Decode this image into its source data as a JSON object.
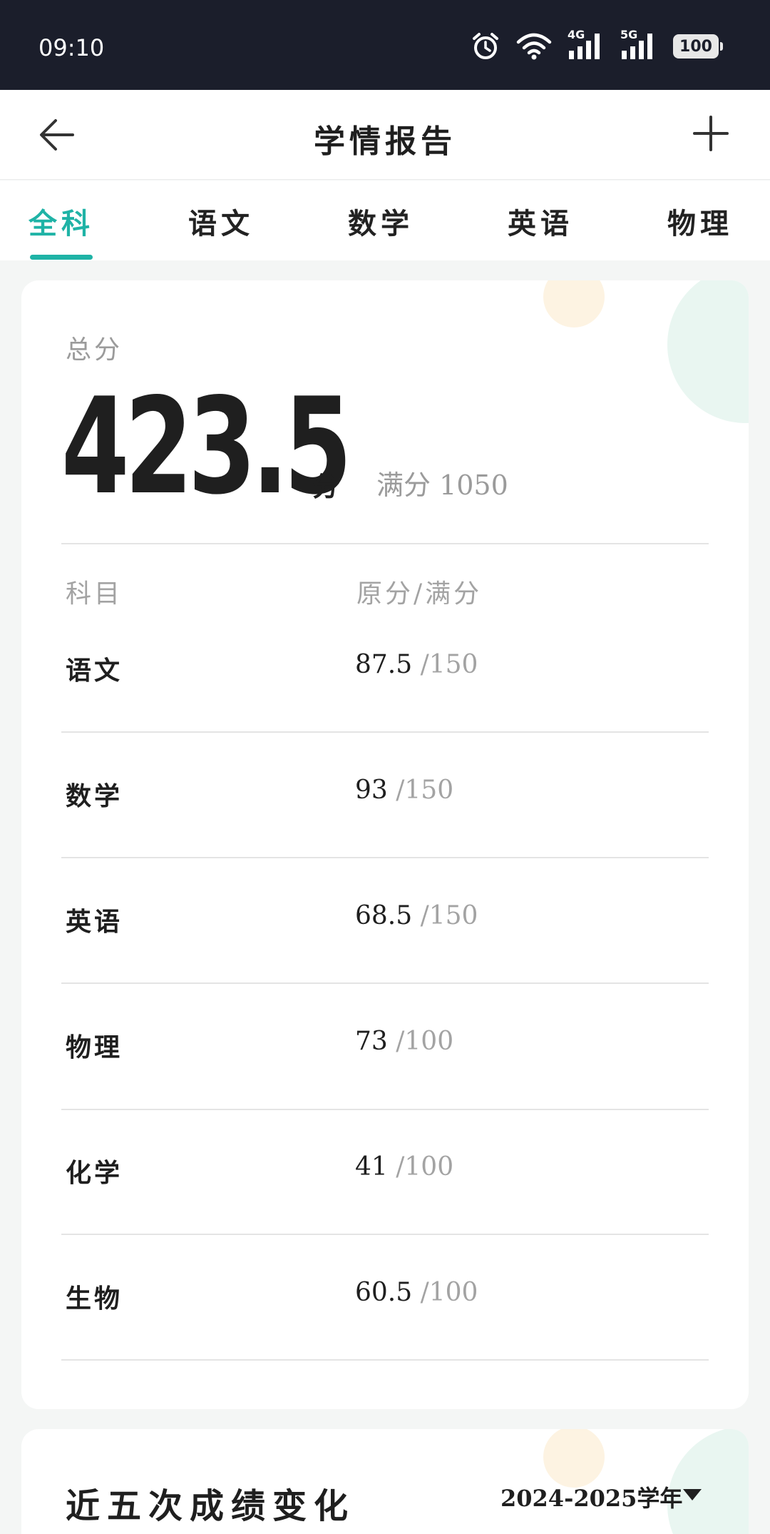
{
  "status_bar": {
    "time": "09:10",
    "net1": "4G",
    "net2": "5G",
    "battery": "100"
  },
  "header": {
    "title": "学情报告"
  },
  "tabs": [
    {
      "label": "全科",
      "active": true
    },
    {
      "label": "语文",
      "active": false
    },
    {
      "label": "数学",
      "active": false
    },
    {
      "label": "英语",
      "active": false
    },
    {
      "label": "物理",
      "active": false
    }
  ],
  "summary": {
    "total_label": "总分",
    "total_score": "423.5",
    "unit": "分",
    "full_label": "满分 1050"
  },
  "table": {
    "col_subject": "科目",
    "col_score": "原分/满分",
    "rows": [
      {
        "subject": "语文",
        "score": "87.5",
        "max": "/150"
      },
      {
        "subject": "数学",
        "score": "93",
        "max": "/150"
      },
      {
        "subject": "英语",
        "score": "68.5",
        "max": "/150"
      },
      {
        "subject": "物理",
        "score": "73",
        "max": "/100"
      },
      {
        "subject": "化学",
        "score": "41",
        "max": "/100"
      },
      {
        "subject": "生物",
        "score": "60.5",
        "max": "/100"
      }
    ]
  },
  "trend": {
    "title": "近五次成绩变化",
    "year": "2024-2025学年"
  },
  "colors": {
    "accent": "#1fb3a6",
    "status_bar": "#1b1e2b",
    "muted": "#a3a3a3"
  }
}
